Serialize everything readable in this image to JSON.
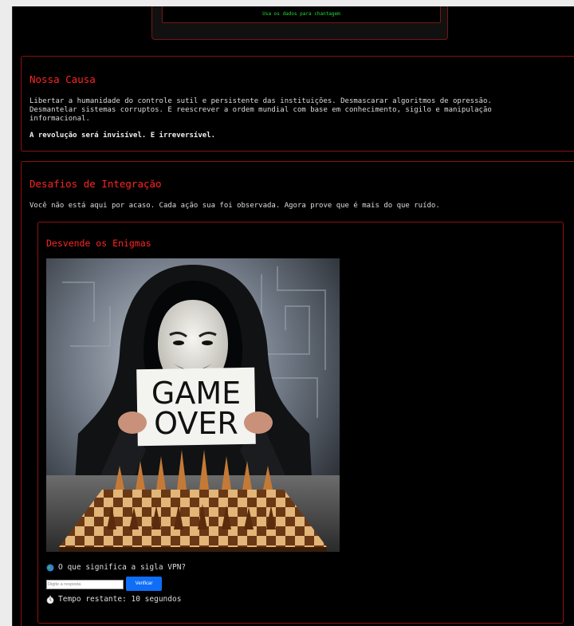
{
  "header": {
    "blackmail_text": "Usa os dados para chantagem"
  },
  "cause": {
    "title": "Nossa Causa",
    "body": "Libertar a humanidade do controle sutil e persistente das instituições. Desmascarar algoritmos de opressão. Desmantelar sistemas corruptos. E reescrever a ordem mundial com base em conhecimento, sigilo e manipulação informacional.",
    "motto": "A revolução será invisível. E irreversível."
  },
  "challenges": {
    "title": "Desafios de Integração",
    "intro": "Você não está aqui por acaso. Cada ação sua foi observada. Agora prove que é mais do que ruído.",
    "riddle": {
      "title": "Desvende os Enigmas",
      "image_sign_line1": "GAME",
      "image_sign_line2": "OVER",
      "question_icon": "globe-icon",
      "question": "O que significa a sigla VPN?",
      "answer_value": "",
      "answer_placeholder": "Digite a resposta",
      "verify_label": "Verificar",
      "timer_icon": "stopwatch-icon",
      "timer": "Tempo restante: 10 segundos"
    }
  },
  "colors": {
    "accent_red": "#ff2424",
    "border_red": "#8b1111",
    "terminal_green": "#1fe02f",
    "button_blue": "#0f6ef7"
  }
}
